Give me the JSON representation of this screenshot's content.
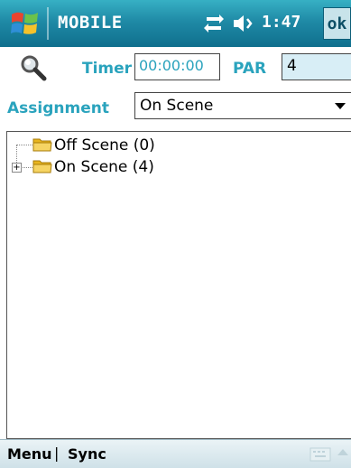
{
  "titlebar": {
    "app_title": "MOBILE",
    "clock": "1:47",
    "ok_label": "ok",
    "icons": [
      "windows-flag-icon",
      "connectivity-icon",
      "volume-icon"
    ]
  },
  "form": {
    "search_icon": "magnifier-icon",
    "timer_label": "Timer",
    "timer_value": "00:00:00",
    "par_label": "PAR",
    "par_value": "4",
    "assignment_label": "Assignment",
    "assignment_value": "On Scene"
  },
  "tree": {
    "items": [
      {
        "label": "Off Scene (0)",
        "expandable": false
      },
      {
        "label": "On Scene (4)",
        "expandable": true
      }
    ]
  },
  "bottombar": {
    "menu_label": "Menu",
    "separator": "|",
    "sync_label": "Sync",
    "keyboard_icon": "keyboard-icon"
  },
  "colors": {
    "titlebar_top": "#37b0c4",
    "titlebar_bottom": "#0f6f8d",
    "label_accent": "#2aa3bd",
    "input_highlight": "#d8eef6"
  }
}
